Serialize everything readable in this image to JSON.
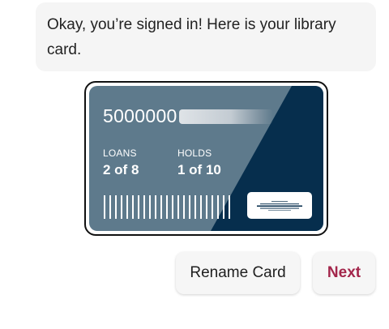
{
  "message": {
    "text": "Okay, you’re signed in! Here is your library card."
  },
  "card": {
    "number_visible": "5000000",
    "loans": {
      "label": "LOANS",
      "value": "2 of 8"
    },
    "holds": {
      "label": "HOLDS",
      "value": "1 of 10"
    },
    "colors": {
      "light_panel": "#5e7a8c",
      "dark_panel": "#062e4d"
    }
  },
  "buttons": {
    "rename_label": "Rename Card",
    "next_label": "Next"
  },
  "colors": {
    "accent": "#a3264b",
    "bubble_bg": "#f5f5f5"
  }
}
